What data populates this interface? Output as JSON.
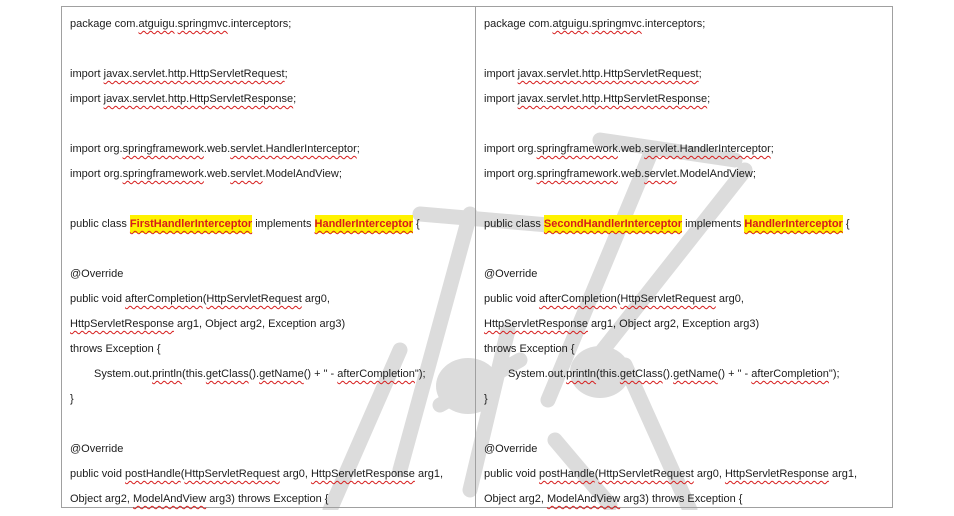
{
  "colors": {
    "highlight": "#fff200",
    "highlight_text": "#d61c1c",
    "spellcheck": "#d61c1c",
    "border": "#a0a0a0",
    "text": "#1c1c1c",
    "watermark": "#dcdcdc"
  },
  "columns": [
    {
      "lines": [
        {
          "segments": [
            {
              "text": "package com."
            },
            {
              "text": "atguigu",
              "style": "sq"
            },
            {
              "text": "."
            },
            {
              "text": "springmvc",
              "style": "sq"
            },
            {
              "text": ".interceptors;"
            }
          ]
        },
        {
          "segments": []
        },
        {
          "segments": [
            {
              "text": "import "
            },
            {
              "text": "javax.servlet.http.HttpServletRequest",
              "style": "sq"
            },
            {
              "text": ";"
            }
          ]
        },
        {
          "segments": [
            {
              "text": "import "
            },
            {
              "text": "javax.servlet.http.HttpServletResponse",
              "style": "sq"
            },
            {
              "text": ";"
            }
          ]
        },
        {
          "segments": []
        },
        {
          "segments": [
            {
              "text": "import org."
            },
            {
              "text": "springframework",
              "style": "sq"
            },
            {
              "text": ".web."
            },
            {
              "text": "servlet.HandlerInterceptor",
              "style": "sq"
            },
            {
              "text": ";"
            }
          ]
        },
        {
          "segments": [
            {
              "text": "import org."
            },
            {
              "text": "springframework",
              "style": "sq"
            },
            {
              "text": ".web."
            },
            {
              "text": "servlet",
              "style": "sq"
            },
            {
              "text": ".ModelAndView;"
            }
          ]
        },
        {
          "segments": []
        },
        {
          "segments": [
            {
              "text": "public class "
            },
            {
              "text": "FirstHandlerInterceptor",
              "style": "hl"
            },
            {
              "text": " implements "
            },
            {
              "text": "HandlerInterceptor",
              "style": "hl"
            },
            {
              "text": " {"
            }
          ]
        },
        {
          "segments": []
        },
        {
          "segments": [
            {
              "text": "@Override"
            }
          ]
        },
        {
          "segments": [
            {
              "text": "public void "
            },
            {
              "text": "afterCompletion",
              "style": "sq"
            },
            {
              "text": "("
            },
            {
              "text": "HttpServletRequest",
              "style": "sq"
            },
            {
              "text": " arg0,"
            }
          ]
        },
        {
          "segments": [
            {
              "text": "HttpServletResponse",
              "style": "sq"
            },
            {
              "text": " arg1, Object arg2, Exception arg3)"
            }
          ]
        },
        {
          "segments": [
            {
              "text": "throws Exception {"
            }
          ]
        },
        {
          "indent": true,
          "segments": [
            {
              "text": "System.out."
            },
            {
              "text": "println",
              "style": "sq"
            },
            {
              "text": "(this."
            },
            {
              "text": "getClass",
              "style": "sq"
            },
            {
              "text": "()."
            },
            {
              "text": "getName",
              "style": "sq"
            },
            {
              "text": "() + \" - "
            },
            {
              "text": "afterCompletion",
              "style": "sq"
            },
            {
              "text": "\");"
            }
          ]
        },
        {
          "segments": [
            {
              "text": "}"
            }
          ]
        },
        {
          "segments": []
        },
        {
          "segments": [
            {
              "text": "@Override"
            }
          ]
        },
        {
          "segments": [
            {
              "text": "public void "
            },
            {
              "text": "postHandle",
              "style": "sq"
            },
            {
              "text": "("
            },
            {
              "text": "HttpServletRequest",
              "style": "sq"
            },
            {
              "text": " arg0, "
            },
            {
              "text": "HttpServletResponse",
              "style": "sq"
            },
            {
              "text": " arg1,"
            }
          ]
        },
        {
          "segments": [
            {
              "text": "Object arg2, "
            },
            {
              "text": "ModelAndView",
              "style": "sq"
            },
            {
              "text": " arg3) throws Exception {"
            }
          ]
        }
      ]
    },
    {
      "lines": [
        {
          "segments": [
            {
              "text": "package com."
            },
            {
              "text": "atguigu",
              "style": "sq"
            },
            {
              "text": "."
            },
            {
              "text": "springmvc",
              "style": "sq"
            },
            {
              "text": ".interceptors;"
            }
          ]
        },
        {
          "segments": []
        },
        {
          "segments": [
            {
              "text": "import "
            },
            {
              "text": "javax.servlet.http.HttpServletRequest",
              "style": "sq"
            },
            {
              "text": ";"
            }
          ]
        },
        {
          "segments": [
            {
              "text": "import "
            },
            {
              "text": "javax.servlet.http.HttpServletResponse",
              "style": "sq"
            },
            {
              "text": ";"
            }
          ]
        },
        {
          "segments": []
        },
        {
          "segments": [
            {
              "text": "import org."
            },
            {
              "text": "springframework",
              "style": "sq"
            },
            {
              "text": ".web."
            },
            {
              "text": "servlet.HandlerInterceptor",
              "style": "sq"
            },
            {
              "text": ";"
            }
          ]
        },
        {
          "segments": [
            {
              "text": "import org."
            },
            {
              "text": "springframework",
              "style": "sq"
            },
            {
              "text": ".web."
            },
            {
              "text": "servlet",
              "style": "sq"
            },
            {
              "text": ".ModelAndView;"
            }
          ]
        },
        {
          "segments": []
        },
        {
          "segments": [
            {
              "text": "public class "
            },
            {
              "text": "SecondHandlerInterceptor",
              "style": "hl"
            },
            {
              "text": " implements "
            },
            {
              "text": "HandlerInterceptor",
              "style": "hl"
            },
            {
              "text": " {"
            }
          ]
        },
        {
          "segments": []
        },
        {
          "segments": [
            {
              "text": "@Override"
            }
          ]
        },
        {
          "segments": [
            {
              "text": "public void "
            },
            {
              "text": "afterCompletion",
              "style": "sq"
            },
            {
              "text": "("
            },
            {
              "text": "HttpServletRequest",
              "style": "sq"
            },
            {
              "text": " arg0,"
            }
          ]
        },
        {
          "segments": [
            {
              "text": "HttpServletResponse",
              "style": "sq"
            },
            {
              "text": " arg1, Object arg2, Exception arg3)"
            }
          ]
        },
        {
          "segments": [
            {
              "text": "throws Exception {"
            }
          ]
        },
        {
          "indent": true,
          "segments": [
            {
              "text": "System.out."
            },
            {
              "text": "println",
              "style": "sq"
            },
            {
              "text": "(this."
            },
            {
              "text": "getClass",
              "style": "sq"
            },
            {
              "text": "()."
            },
            {
              "text": "getName",
              "style": "sq"
            },
            {
              "text": "() + \" - "
            },
            {
              "text": "afterCompletion",
              "style": "sq"
            },
            {
              "text": "\");"
            }
          ]
        },
        {
          "segments": [
            {
              "text": "}"
            }
          ]
        },
        {
          "segments": []
        },
        {
          "segments": [
            {
              "text": "@Override"
            }
          ]
        },
        {
          "segments": [
            {
              "text": "public void "
            },
            {
              "text": "postHandle",
              "style": "sq"
            },
            {
              "text": "("
            },
            {
              "text": "HttpServletRequest",
              "style": "sq"
            },
            {
              "text": " arg0, "
            },
            {
              "text": "HttpServletResponse",
              "style": "sq"
            },
            {
              "text": " arg1,"
            }
          ]
        },
        {
          "segments": [
            {
              "text": "Object arg2, "
            },
            {
              "text": "ModelAndView",
              "style": "sq"
            },
            {
              "text": " arg3) throws Exception {"
            }
          ]
        }
      ]
    }
  ]
}
